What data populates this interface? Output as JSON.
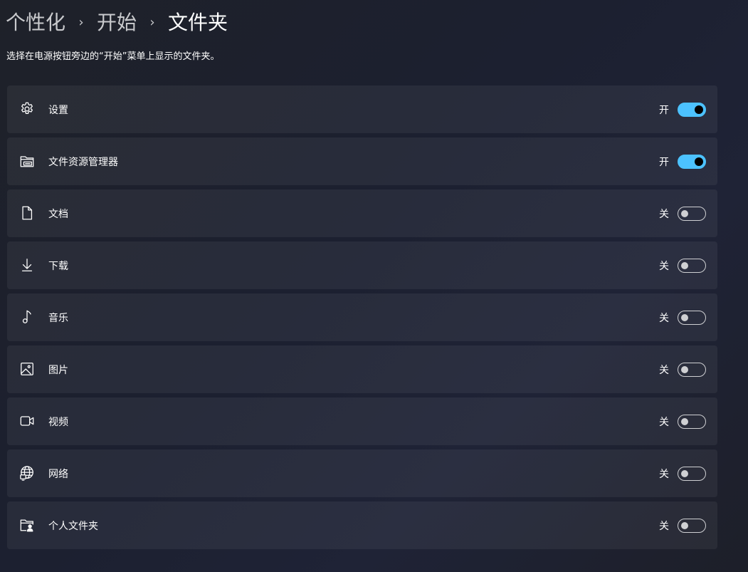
{
  "breadcrumb": {
    "items": [
      "个性化",
      "开始",
      "文件夹"
    ],
    "separator": "›"
  },
  "description": "选择在电源按钮旁边的“开始”菜单上显示的文件夹。",
  "colors": {
    "accent": "#4cc2ff",
    "row_background": "rgba(255,255,255,0.055)"
  },
  "folders": [
    {
      "label": "设置",
      "icon": "gear-icon",
      "state_text": "开",
      "on": true
    },
    {
      "label": "文件资源管理器",
      "icon": "file-explorer-icon",
      "state_text": "开",
      "on": true
    },
    {
      "label": "文档",
      "icon": "document-icon",
      "state_text": "关",
      "on": false
    },
    {
      "label": "下载",
      "icon": "download-icon",
      "state_text": "关",
      "on": false
    },
    {
      "label": "音乐",
      "icon": "music-icon",
      "state_text": "关",
      "on": false
    },
    {
      "label": "图片",
      "icon": "picture-icon",
      "state_text": "关",
      "on": false
    },
    {
      "label": "视频",
      "icon": "video-icon",
      "state_text": "关",
      "on": false
    },
    {
      "label": "网络",
      "icon": "network-icon",
      "state_text": "关",
      "on": false
    },
    {
      "label": "个人文件夹",
      "icon": "personal-folder-icon",
      "state_text": "关",
      "on": false
    }
  ]
}
